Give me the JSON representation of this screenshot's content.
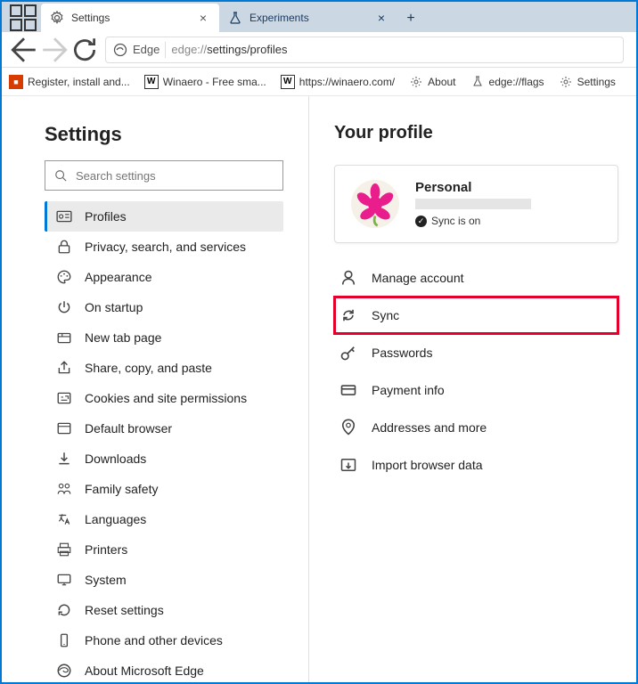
{
  "titlebar": {
    "tabs": [
      {
        "label": "Settings",
        "icon": "gear-icon",
        "active": true
      },
      {
        "label": "Experiments",
        "icon": "flask-icon",
        "active": false
      }
    ]
  },
  "toolbar": {
    "edge_label": "Edge",
    "url_prefix": "edge://",
    "url_rest": "settings/profiles"
  },
  "bookmarks": [
    {
      "label": "Register, install and...",
      "icon": "red-square"
    },
    {
      "label": "Winaero - Free sma...",
      "icon": "w-square"
    },
    {
      "label": "https://winaero.com/",
      "icon": "w-square"
    },
    {
      "label": "About",
      "icon": "gear-icon"
    },
    {
      "label": "edge://flags",
      "icon": "flask-icon"
    },
    {
      "label": "Settings",
      "icon": "gear-icon"
    }
  ],
  "sidebar": {
    "title": "Settings",
    "search_placeholder": "Search settings",
    "items": [
      {
        "label": "Profiles",
        "icon": "profile-card-icon",
        "active": true
      },
      {
        "label": "Privacy, search, and services",
        "icon": "lock-icon"
      },
      {
        "label": "Appearance",
        "icon": "palette-icon"
      },
      {
        "label": "On startup",
        "icon": "power-icon"
      },
      {
        "label": "New tab page",
        "icon": "tab-icon"
      },
      {
        "label": "Share, copy, and paste",
        "icon": "share-icon"
      },
      {
        "label": "Cookies and site permissions",
        "icon": "permissions-icon"
      },
      {
        "label": "Default browser",
        "icon": "browser-icon"
      },
      {
        "label": "Downloads",
        "icon": "download-icon"
      },
      {
        "label": "Family safety",
        "icon": "family-icon"
      },
      {
        "label": "Languages",
        "icon": "language-icon"
      },
      {
        "label": "Printers",
        "icon": "printer-icon"
      },
      {
        "label": "System",
        "icon": "system-icon"
      },
      {
        "label": "Reset settings",
        "icon": "reset-icon"
      },
      {
        "label": "Phone and other devices",
        "icon": "phone-icon"
      },
      {
        "label": "About Microsoft Edge",
        "icon": "edge-icon"
      }
    ]
  },
  "main": {
    "title": "Your profile",
    "profile": {
      "name": "Personal",
      "sync_status": "Sync is on"
    },
    "menu": [
      {
        "label": "Manage account",
        "icon": "person-icon"
      },
      {
        "label": "Sync",
        "icon": "sync-icon",
        "highlighted": true
      },
      {
        "label": "Passwords",
        "icon": "key-icon"
      },
      {
        "label": "Payment info",
        "icon": "card-icon"
      },
      {
        "label": "Addresses and more",
        "icon": "pin-icon"
      },
      {
        "label": "Import browser data",
        "icon": "import-icon"
      }
    ]
  }
}
